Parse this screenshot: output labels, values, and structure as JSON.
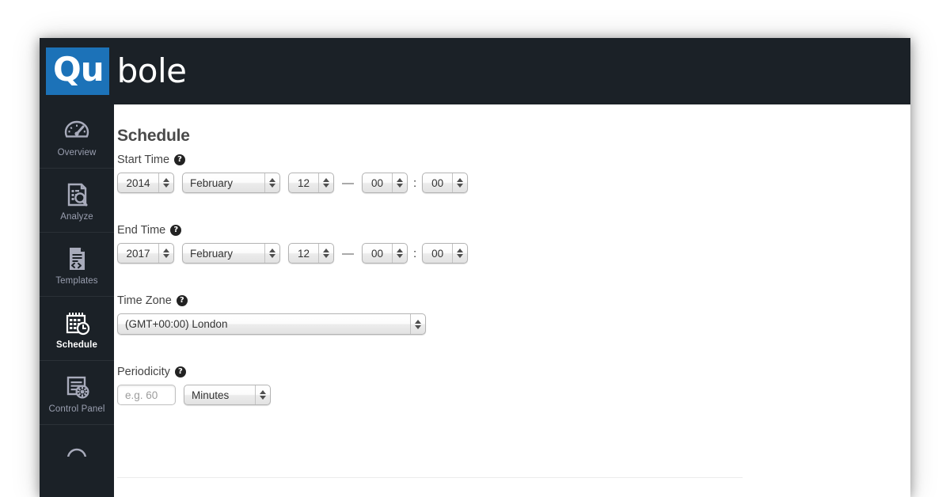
{
  "brand": {
    "logo_mark": "Qu",
    "logo_text": "bole"
  },
  "sidebar": {
    "items": [
      {
        "label": "Overview",
        "icon": "gauge-icon",
        "active": false
      },
      {
        "label": "Analyze",
        "icon": "document-search-icon",
        "active": false
      },
      {
        "label": "Templates",
        "icon": "document-code-icon",
        "active": false
      },
      {
        "label": "Schedule",
        "icon": "calendar-clock-icon",
        "active": true
      },
      {
        "label": "Control Panel",
        "icon": "document-gear-icon",
        "active": false
      }
    ]
  },
  "main": {
    "title": "Schedule",
    "help_glyph": "?",
    "dash": "—",
    "colon": ":",
    "fields": {
      "start_time": {
        "label": "Start Time",
        "year": "2014",
        "month": "February",
        "day": "12",
        "hour": "00",
        "minute": "00"
      },
      "end_time": {
        "label": "End Time",
        "year": "2017",
        "month": "February",
        "day": "12",
        "hour": "00",
        "minute": "00"
      },
      "time_zone": {
        "label": "Time Zone",
        "value": "(GMT+00:00) London"
      },
      "periodicity": {
        "label": "Periodicity",
        "placeholder": "e.g. 60",
        "value": "",
        "unit": "Minutes"
      }
    }
  },
  "colors": {
    "brand_blue": "#1c72b8",
    "sidebar_bg": "#1b2127",
    "active_text": "#ffffff",
    "inactive_text": "#9a9fb0"
  }
}
